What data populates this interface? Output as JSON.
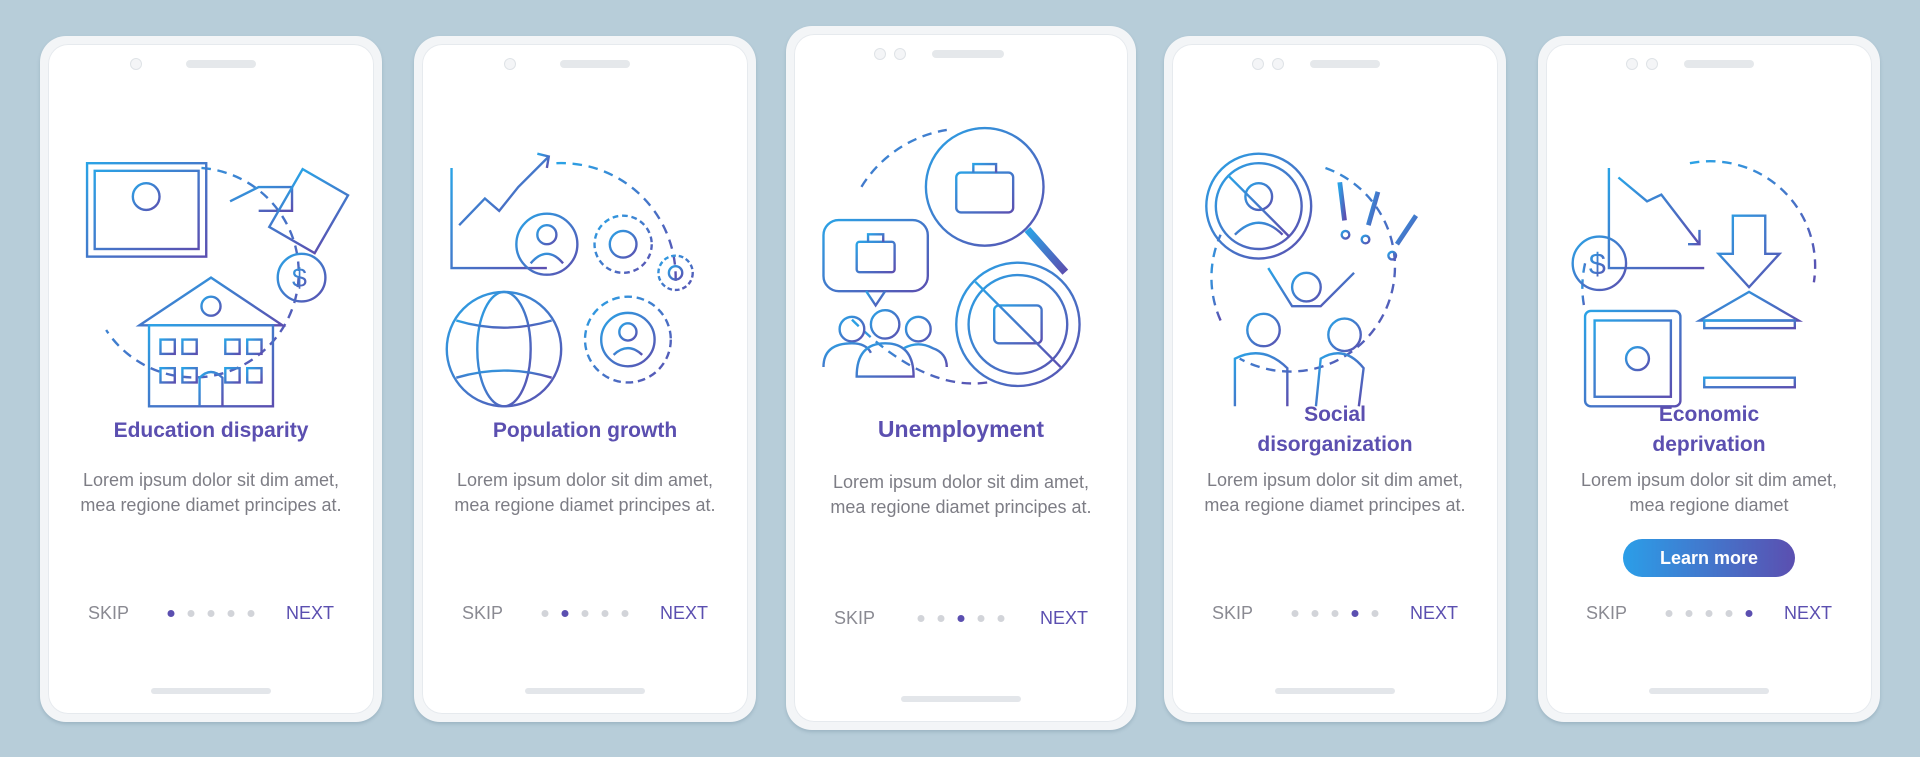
{
  "screens": [
    {
      "title": "Education disparity",
      "body": "Lorem ipsum dolor sit dim amet, mea regione diamet principes at.",
      "skip": "SKIP",
      "next": "NEXT",
      "active_step": 1,
      "total_steps": 5,
      "illustration": "education-icon"
    },
    {
      "title": "Population growth",
      "body": "Lorem ipsum dolor sit dim amet, mea regione diamet principes at.",
      "skip": "SKIP",
      "next": "NEXT",
      "active_step": 2,
      "total_steps": 5,
      "illustration": "population-icon"
    },
    {
      "title": "Unemployment",
      "body": "Lorem ipsum dolor sit dim amet, mea regione diamet principes at.",
      "skip": "SKIP",
      "next": "NEXT",
      "active_step": 3,
      "total_steps": 5,
      "illustration": "unemployment-icon"
    },
    {
      "title_line1": "Social",
      "title_line2": "disorganization",
      "body": "Lorem ipsum dolor sit dim amet, mea regione diamet principes at.",
      "skip": "SKIP",
      "next": "NEXT",
      "active_step": 4,
      "total_steps": 5,
      "illustration": "social-icon"
    },
    {
      "title_line1": "Economic",
      "title_line2": "deprivation",
      "body": "Lorem ipsum dolor sit dim amet, mea regione diamet",
      "skip": "SKIP",
      "next": "NEXT",
      "active_step": 5,
      "total_steps": 5,
      "button": "Learn more",
      "illustration": "economic-icon"
    }
  ],
  "colors": {
    "accent": "#5b4fb0",
    "gradient_start": "#2b9ee8",
    "background": "#b7cdd9"
  }
}
